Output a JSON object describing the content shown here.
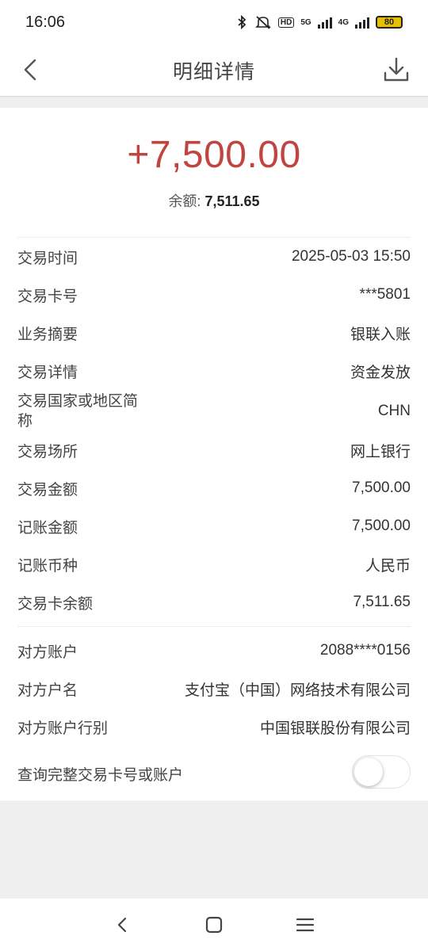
{
  "status_bar": {
    "time": "16:06",
    "net1": "5G",
    "net2": "4G",
    "hd": "HD",
    "battery": "80",
    "icons": [
      "bluetooth-icon",
      "mute-icon",
      "hd-icon",
      "signal-icon",
      "signal-icon",
      "battery-icon"
    ]
  },
  "header": {
    "title": "明细详情",
    "back_icon": "chevron-left-icon",
    "download_icon": "download-icon"
  },
  "summary": {
    "amount": "+7,500.00",
    "amount_color": "#c0443f",
    "balance_label": "余额:",
    "balance_value": "7,511.65"
  },
  "details": [
    {
      "label": "交易时间",
      "value": "2025-05-03 15:50"
    },
    {
      "label": "交易卡号",
      "value": "***5801"
    },
    {
      "label": "业务摘要",
      "value": "银联入账"
    },
    {
      "label": "交易详情",
      "value": "资金发放"
    },
    {
      "label": "交易国家或地区简称",
      "value": "CHN"
    },
    {
      "label": "交易场所",
      "value": "网上银行"
    },
    {
      "label": "交易金额",
      "value": "7,500.00"
    },
    {
      "label": "记账金额",
      "value": "7,500.00"
    },
    {
      "label": "记账币种",
      "value": "人民币"
    },
    {
      "label": "交易卡余额",
      "value": "7,511.65"
    }
  ],
  "counterparty": [
    {
      "label": "对方账户",
      "value": "2088****0156"
    },
    {
      "label": "对方户名",
      "value": "支付宝（中国）网络技术有限公司"
    },
    {
      "label": "对方账户行别",
      "value": "中国银联股份有限公司"
    }
  ],
  "query_full": {
    "label": "查询完整交易卡号或账户",
    "enabled": false
  },
  "system_nav": {
    "icons": [
      "back-nav-icon",
      "home-nav-icon",
      "menu-nav-icon"
    ]
  }
}
